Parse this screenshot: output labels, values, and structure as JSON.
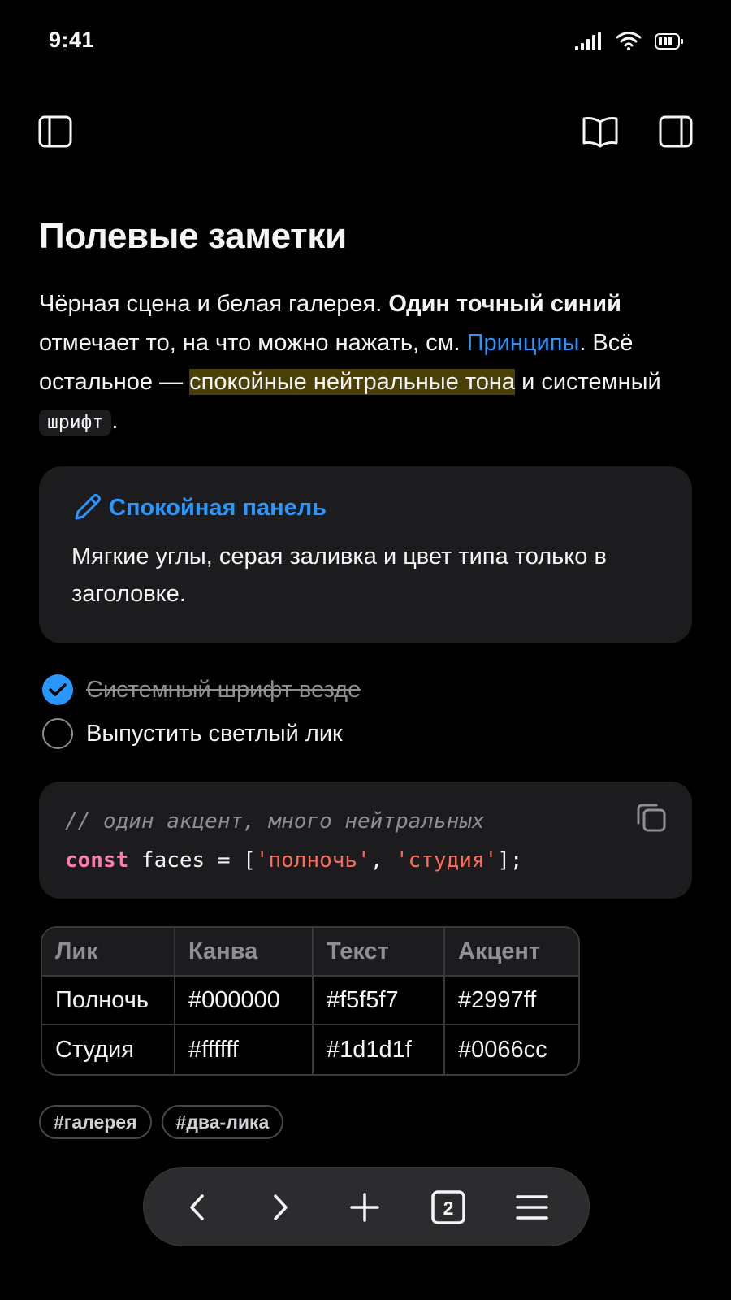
{
  "status_bar": {
    "time": "9:41"
  },
  "toolbar": {
    "sidebar_icon": "sidebar-left-icon",
    "reader_icon": "book-icon",
    "panel_icon": "sidebar-right-icon"
  },
  "note": {
    "title": "Полевые заметки",
    "para": {
      "t1": "Чёрная сцена и белая галерея. ",
      "bold": "Один точный синий",
      "t2": " отмечает то, на что можно нажать, см. ",
      "link": "Принципы",
      "t3": ". Всё остальное — ",
      "highlight": "спокойные нейтральные тона",
      "t4": " и системный ",
      "code": "шрифт",
      "t5": "."
    },
    "callout": {
      "icon": "pencil-icon",
      "title": "Спокойная панель",
      "text": "Мягкие углы, серая заливка и цвет типа только в заголовке."
    },
    "tasks": [
      {
        "label": "Системный шрифт везде",
        "done": true
      },
      {
        "label": "Выпустить светлый лик",
        "done": false
      }
    ],
    "code_block": {
      "comment": "// один акцент, много нейтральных",
      "keyword": "const",
      "ident": " faces = [",
      "str1": "'полночь'",
      "sep": ", ",
      "str2": "'студия'",
      "end": "];"
    },
    "table": {
      "headers": [
        "Лик",
        "Канва",
        "Текст",
        "Акцент"
      ],
      "rows": [
        [
          "Полночь",
          "#000000",
          "#f5f5f7",
          "#2997ff"
        ],
        [
          "Студия",
          "#ffffff",
          "#1d1d1f",
          "#0066cc"
        ]
      ]
    },
    "tags": [
      "#галерея",
      "#два-лика"
    ]
  },
  "bottom_bar": {
    "tab_count": "2"
  },
  "colors": {
    "accent": "#2997ff",
    "background": "#000000",
    "panel": "#1c1c1e",
    "text": "#f5f5f7",
    "highlight": "#4a3f05"
  }
}
